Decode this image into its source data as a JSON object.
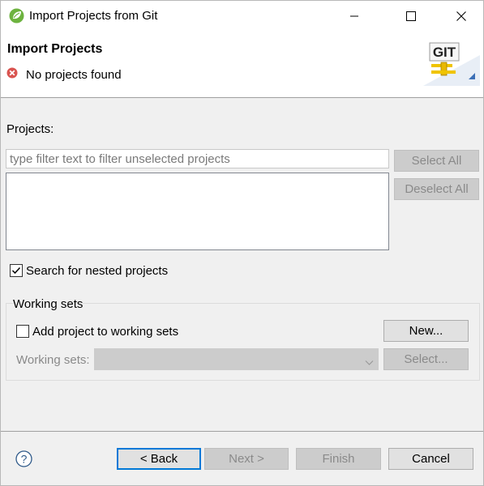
{
  "window": {
    "title": "Import Projects from Git",
    "icon": "spring-leaf-icon"
  },
  "banner": {
    "title": "Import Projects",
    "message": "No projects found",
    "message_icon": "error-icon",
    "logo_text": "GIT"
  },
  "projects": {
    "label": "Projects:",
    "filter_placeholder": "type filter text to filter unselected projects",
    "filter_value": "",
    "select_all_label": "Select All",
    "deselect_all_label": "Deselect All",
    "items": []
  },
  "options": {
    "search_nested_label": "Search for nested projects",
    "search_nested_checked": true
  },
  "working_sets": {
    "group_title": "Working sets",
    "add_label": "Add project to working sets",
    "add_checked": false,
    "new_label": "New...",
    "sets_label": "Working sets:",
    "sets_value": "",
    "select_label": "Select..."
  },
  "footer": {
    "back_label": "< Back",
    "next_label": "Next >",
    "finish_label": "Finish",
    "cancel_label": "Cancel"
  },
  "colors": {
    "focus_border": "#0078d7",
    "error_red": "#d9534f"
  }
}
